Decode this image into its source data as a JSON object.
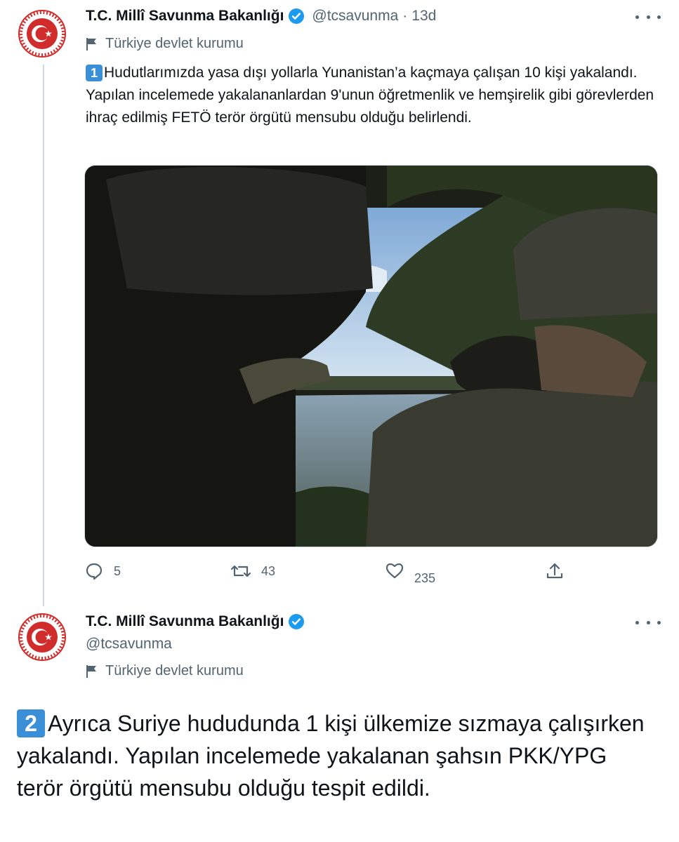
{
  "tweet1": {
    "author": {
      "name": "T.C. Millî Savunma Bakanlığı",
      "handle": "@tcsavunma",
      "dot": "·",
      "time": "13d"
    },
    "label": "Türkiye devlet kurumu",
    "keycap": "1",
    "text": "Hudutlarımızda yasa dışı yollarla Yunanistan’a kaçmaya çalışan 10 kişi yakalandı. Yapılan incelemede yakalananlardan 9'unun öğretmenlik ve hemşirelik gibi görevlerden ihraç edilmiş FETÖ terör örgütü mensubu olduğu belirlendi.",
    "stats": {
      "replies": "5",
      "retweets": "43",
      "likes": "235"
    }
  },
  "tweet2": {
    "author": {
      "name": "T.C. Millî Savunma Bakanlığı",
      "handle": "@tcsavunma"
    },
    "label": "Türkiye devlet kurumu",
    "keycap": "2",
    "text": "Ayrıca Suriye hududunda 1 kişi ülkemize sızmaya çalışırken yakalandı. Yapılan incelemede yakalanan şahsın PKK/YPG terör örgütü mensubu olduğu tespit edildi."
  },
  "icons": {
    "verified": "verified-badge-icon",
    "label": "flag-icon",
    "more": "more-horizontal-icon",
    "reply": "reply-icon",
    "retweet": "retweet-icon",
    "like": "heart-icon",
    "share": "share-icon"
  },
  "colors": {
    "accent": "#1d9bf0",
    "secondary_text": "#536471",
    "logo_red": "#d12c2c",
    "keycap": "#3b8fd6"
  }
}
